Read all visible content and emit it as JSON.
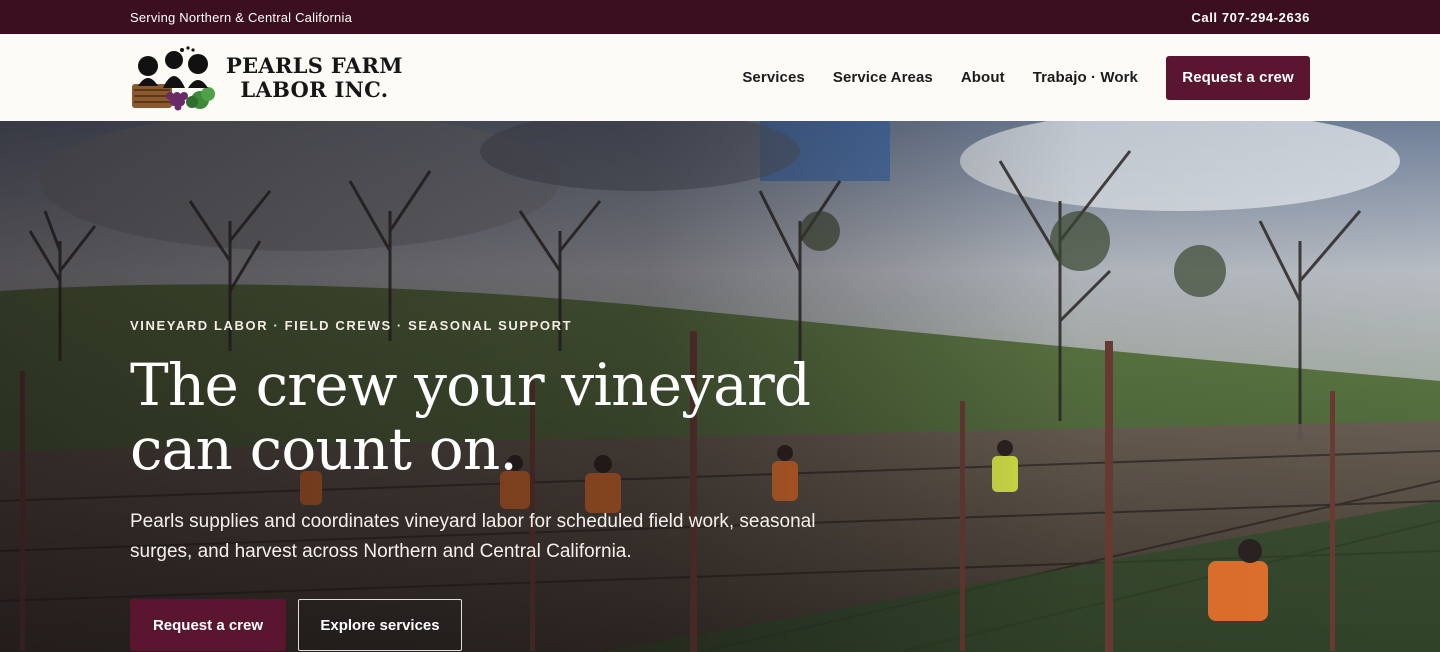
{
  "topbar": {
    "tagline": "Serving Northern & Central California",
    "phone": "Call 707-294-2636"
  },
  "header": {
    "brand_line1": "PEARLS FARM",
    "brand_line2": "LABOR INC.",
    "nav": [
      {
        "label": "Services"
      },
      {
        "label": "Service Areas"
      },
      {
        "label": "About"
      },
      {
        "label": "Trabajo · Work"
      }
    ],
    "cta_label": "Request a crew"
  },
  "hero": {
    "eyebrow": "VINEYARD LABOR · FIELD CREWS · SEASONAL SUPPORT",
    "headline": "The crew your vineyard can count on.",
    "lede": "Pearls supplies and coordinates vineyard labor for scheduled field work, seasonal surges, and harvest across Northern and Central California.",
    "primary_label": "Request a crew",
    "secondary_label": "Explore services"
  },
  "colors": {
    "topbar_bg": "#3b0f1f",
    "brand_accent": "#5a1530",
    "header_bg": "#fdfbf6"
  },
  "icons": {
    "logo": "silhouette-women-grape-basket-logo",
    "hero_image": "vineyard-workers-photo"
  }
}
